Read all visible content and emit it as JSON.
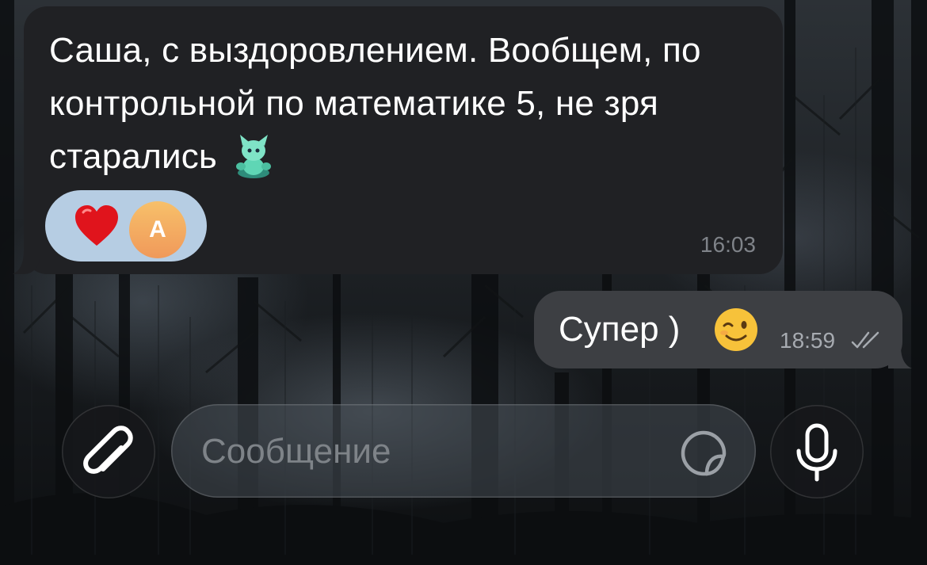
{
  "chat": {
    "incoming": {
      "text": "Саша, с выздоровлением. Вообщем, по контрольной по математике 5, не зря старались",
      "sticker_emoji": "green-cat-sticker",
      "reactions": {
        "emoji": "heart-icon",
        "avatar_letter": "А"
      },
      "time": "16:03"
    },
    "outgoing": {
      "text": "Супер )",
      "emoji": "winking-face-icon",
      "time": "18:59",
      "status": "read"
    }
  },
  "composer": {
    "placeholder": "Сообщение",
    "attach_icon": "paperclip-icon",
    "sticker_icon": "sticker-icon",
    "mic_icon": "microphone-icon"
  },
  "colors": {
    "incoming_bubble": "#202124",
    "outgoing_bubble": "#3d3f43",
    "reaction_pill": "#b6cde3",
    "avatar": "#f0a35e"
  }
}
